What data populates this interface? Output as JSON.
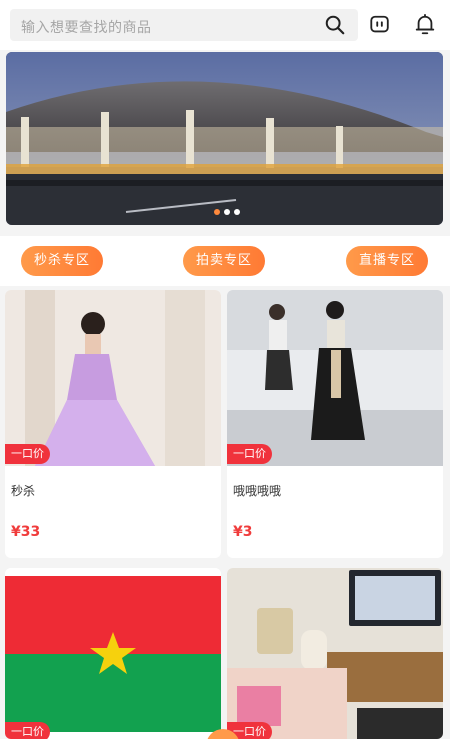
{
  "search": {
    "placeholder": "输入想要查找的商品"
  },
  "header_icons": {
    "search": "search-icon",
    "message": "chat-icon",
    "notify": "bell-icon"
  },
  "banner": {
    "slides": 3,
    "active_slide": 1
  },
  "categories": [
    {
      "label": "秒杀专区"
    },
    {
      "label": "拍卖专区"
    },
    {
      "label": "直播专区"
    }
  ],
  "products": [
    {
      "tag": "一口价",
      "title": "秒杀",
      "price": "¥33"
    },
    {
      "tag": "一口价",
      "title": "哦哦哦哦",
      "price": "¥3"
    },
    {
      "tag": "一口价",
      "title": "",
      "price": ""
    },
    {
      "tag": "一口价",
      "title": "",
      "price": ""
    }
  ],
  "colors": {
    "accent": "#ff8a3d",
    "price": "#f03c3c",
    "tag": "#f0323c"
  }
}
